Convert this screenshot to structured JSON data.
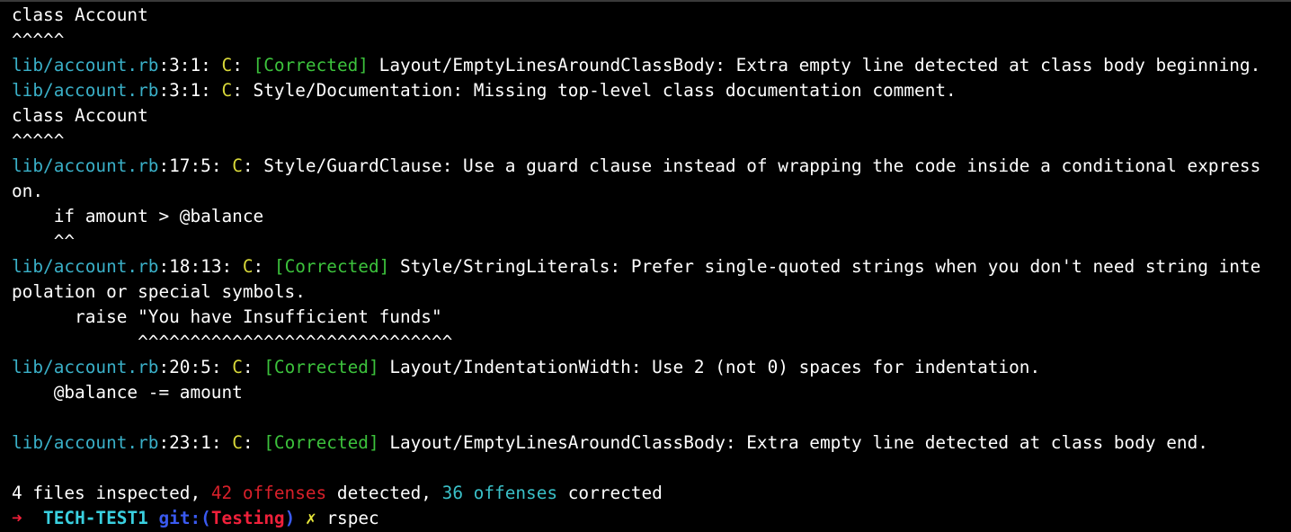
{
  "terminal": {
    "lines": [
      {
        "kind": "code",
        "text": "class Account"
      },
      {
        "kind": "caret",
        "text": "^^^^^"
      },
      {
        "kind": "offense",
        "file": "lib/account.rb",
        "pos": ":3:1: ",
        "severity": "C",
        "sep": ": ",
        "tag": "[Corrected]",
        "message": " Layout/EmptyLinesAroundClassBody: Extra empty line detected at class body beginning."
      },
      {
        "kind": "offense",
        "file": "lib/account.rb",
        "pos": ":3:1: ",
        "severity": "C",
        "sep": ": ",
        "tag": "",
        "message": "Style/Documentation: Missing top-level class documentation comment."
      },
      {
        "kind": "code",
        "text": "class Account"
      },
      {
        "kind": "caret",
        "text": "^^^^^"
      },
      {
        "kind": "offense",
        "file": "lib/account.rb",
        "pos": ":17:5: ",
        "severity": "C",
        "sep": ": ",
        "tag": "",
        "message": "Style/GuardClause: Use a guard clause instead of wrapping the code inside a conditional express"
      },
      {
        "kind": "code",
        "text": "on."
      },
      {
        "kind": "code",
        "text": "    if amount > @balance"
      },
      {
        "kind": "caret",
        "text": "    ^^"
      },
      {
        "kind": "offense",
        "file": "lib/account.rb",
        "pos": ":18:13: ",
        "severity": "C",
        "sep": ": ",
        "tag": "[Corrected]",
        "message": " Style/StringLiterals: Prefer single-quoted strings when you don't need string inte"
      },
      {
        "kind": "code",
        "text": "polation or special symbols."
      },
      {
        "kind": "code",
        "text": "      raise \"You have Insufficient funds\""
      },
      {
        "kind": "caret",
        "text": "            ^^^^^^^^^^^^^^^^^^^^^^^^^^^^^^"
      },
      {
        "kind": "offense",
        "file": "lib/account.rb",
        "pos": ":20:5: ",
        "severity": "C",
        "sep": ": ",
        "tag": "[Corrected]",
        "message": " Layout/IndentationWidth: Use 2 (not 0) spaces for indentation."
      },
      {
        "kind": "code",
        "text": "    @balance -= amount"
      },
      {
        "kind": "code",
        "text": ""
      },
      {
        "kind": "offense",
        "file": "lib/account.rb",
        "pos": ":23:1: ",
        "severity": "C",
        "sep": ": ",
        "tag": "[Corrected]",
        "message": " Layout/EmptyLinesAroundClassBody: Extra empty line detected at class body end."
      },
      {
        "kind": "code",
        "text": ""
      }
    ],
    "summary": {
      "prefix": "4 files inspected, ",
      "offenses": "42 offenses",
      "middle": " detected, ",
      "corrected_count": "36 offenses",
      "suffix": " corrected"
    },
    "prompt": {
      "arrow": "➜",
      "directory": "TECH-TEST1",
      "git_label": "git:(",
      "branch": "Testing",
      "git_close": ")",
      "dirty_mark": "✗",
      "command": "rspec"
    },
    "colors": {
      "background": "#000000",
      "text": "#ffffff",
      "file_path": "#3ab0c8",
      "severity": "#d9d93a",
      "corrected_tag": "#3cc23c",
      "offense_count": "#d8202a",
      "corrected_count": "#3ac0c8"
    }
  }
}
